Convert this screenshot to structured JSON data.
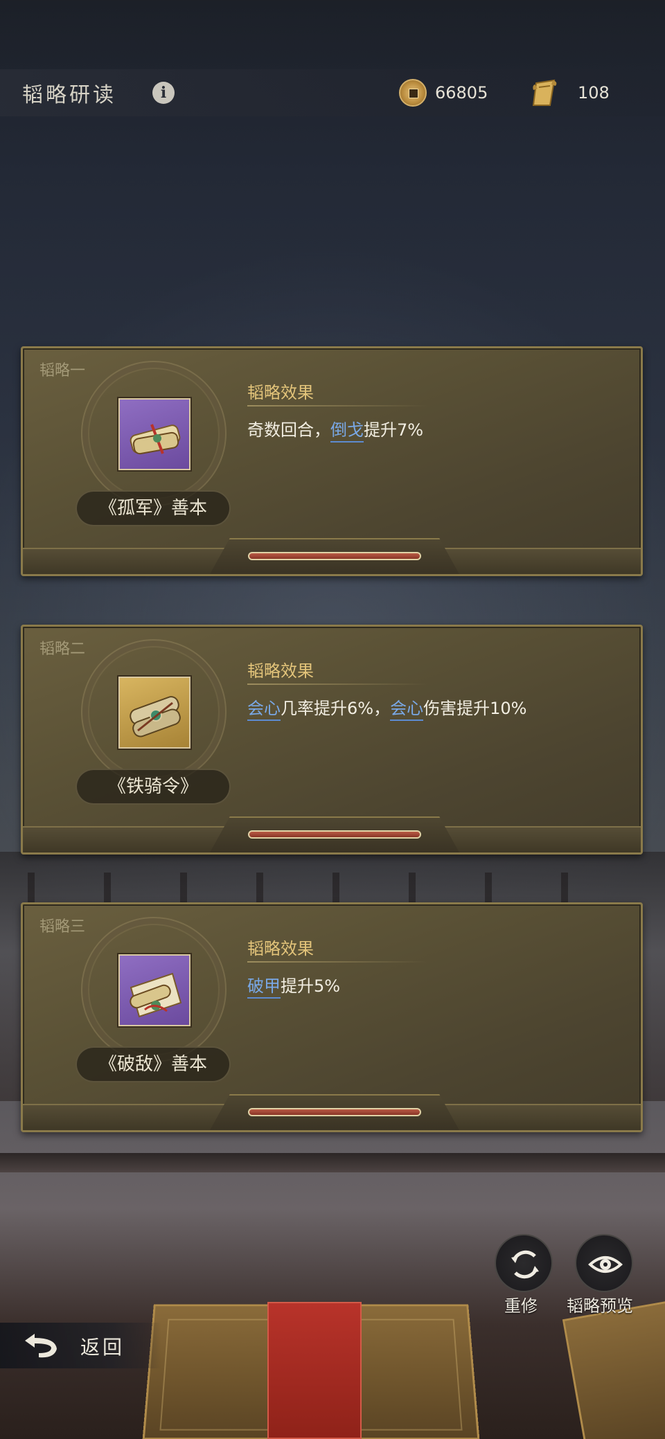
{
  "header": {
    "title": "韬略研读",
    "coins": "66805",
    "scrolls": "108"
  },
  "cards": [
    {
      "label": "韬略一",
      "item_name": "《孤军》善本",
      "effect_title": "韬略效果",
      "effect_parts": [
        "奇数回合，",
        "倒戈",
        "提升7%"
      ],
      "frame": "purple"
    },
    {
      "label": "韬略二",
      "item_name": "《铁骑令》",
      "effect_title": "韬略效果",
      "effect_parts": [
        "会心",
        "几率提升6%，",
        "会心",
        "伤害提升10%"
      ],
      "frame": "gold"
    },
    {
      "label": "韬略三",
      "item_name": "《破敌》善本",
      "effect_title": "韬略效果",
      "effect_parts": [
        "破甲",
        "提升5%"
      ],
      "frame": "purple"
    }
  ],
  "buttons": {
    "reforge": "重修",
    "preview": "韬略预览",
    "back": "返回"
  },
  "icons": {
    "coin": "coin-icon",
    "scroll": "scroll-icon",
    "info": "info-icon",
    "reforge": "refresh-icon",
    "preview": "eye-icon",
    "back": "back-arrow-icon"
  },
  "colors": {
    "keyword": "#79a8e6",
    "effect_title": "#e3c47a",
    "card_border": "#8a7a4a"
  }
}
